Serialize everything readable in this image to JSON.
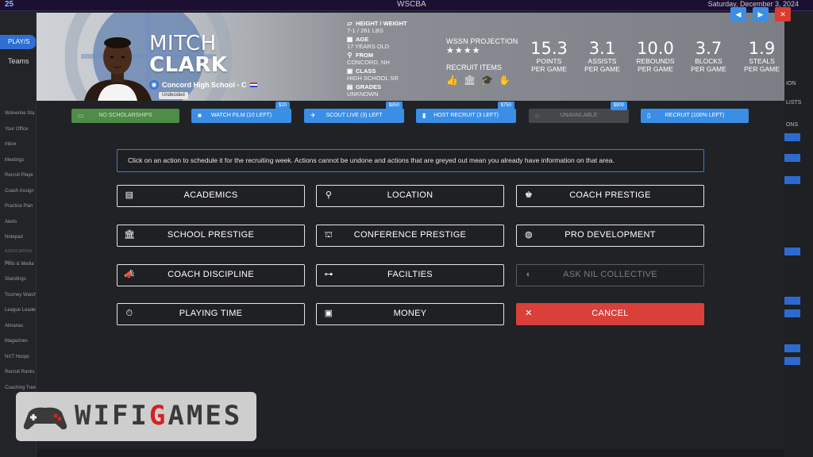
{
  "app": {
    "brand": "25",
    "center_title": "WSCBA",
    "date": "Saturday, December 3, 2024"
  },
  "sidebar": {
    "play_label": "PLAY/S",
    "teams_label": "Teams",
    "items": [
      "Wolverine Sta",
      "Your Office",
      "Inbox",
      "Meetings",
      "Recruit Playe",
      "Coach Assign",
      "Practice Plan",
      "Alerts",
      "Notepad"
    ],
    "section_label": "ASSOCIATION INF",
    "items2": [
      "Polls & Media",
      "Standings",
      "Tourney Watch",
      "League Leaders",
      "Almanac",
      "Magazines",
      "NXT Hoops",
      "Recruit Ranks",
      "Coaching Tree"
    ]
  },
  "right_panel": {
    "labels": [
      "ION",
      "LISTS",
      "ONS"
    ]
  },
  "player": {
    "first_name": "MITCH",
    "last_name": "CLARK",
    "school": "Concord High School - C",
    "status": "Undecided",
    "height_weight_label": "HEIGHT / WEIGHT",
    "height_weight": "7-1 / 261 LBS",
    "age_label": "AGE",
    "age": "17 YEARS OLD",
    "from_label": "FROM",
    "from": "CONCORD, NH",
    "class_label": "CLASS",
    "class": "HIGH SCHOOL SR",
    "grades_label": "GRADES",
    "grades": "UNKNOWN"
  },
  "projection": {
    "label": "WSSN PROJECTION",
    "stars": "★★★★",
    "recruit_items_label": "RECRUIT ITEMS"
  },
  "stats": [
    {
      "value": "15.3",
      "label1": "POINTS",
      "label2": "PER GAME"
    },
    {
      "value": "3.1",
      "label1": "ASSISTS",
      "label2": "PER GAME"
    },
    {
      "value": "10.0",
      "label1": "REBOUNDS",
      "label2": "PER GAME"
    },
    {
      "value": "3.7",
      "label1": "BLOCKS",
      "label2": "PER GAME"
    },
    {
      "value": "1.9",
      "label1": "STEALS",
      "label2": "PER GAME"
    }
  ],
  "action_bar": {
    "no_scholarships": "NO SCHOLARSHIPS",
    "watch_film": "WATCH FILM (10 LEFT)",
    "watch_film_cost": "$20",
    "scout_live": "SCOUT LIVE (3) LEFT",
    "scout_live_cost": "$850",
    "host_recruit": "HOST RECRUIT (3 LEFT)",
    "host_recruit_cost": "$750",
    "unavailable": "UNAVAILABLE",
    "unavailable_cost": "$900",
    "recruit": "RECRUIT (100% LEFT)"
  },
  "notice": "Click on an action to schedule it for the recruiting week. Actions cannot be undone and actions that are greyed out mean you already have information on that area.",
  "options": {
    "academics": "ACADEMICS",
    "location": "LOCATION",
    "coach_prestige": "COACH PRESTIGE",
    "school_prestige": "SCHOOL PRESTIGE",
    "conference_prestige": "CONFERENCE PRESTIGE",
    "pro_development": "PRO DEVELOPMENT",
    "coach_discipline": "COACH DISCIPLINE",
    "facilities": "FACILTIES",
    "ask_nil": "ASK NIL COLLECTIVE",
    "playing_time": "PLAYING TIME",
    "money": "MONEY",
    "cancel": "CANCEL"
  },
  "watermark": {
    "left": "WIFI",
    "g": "G",
    "right": "AMES"
  }
}
